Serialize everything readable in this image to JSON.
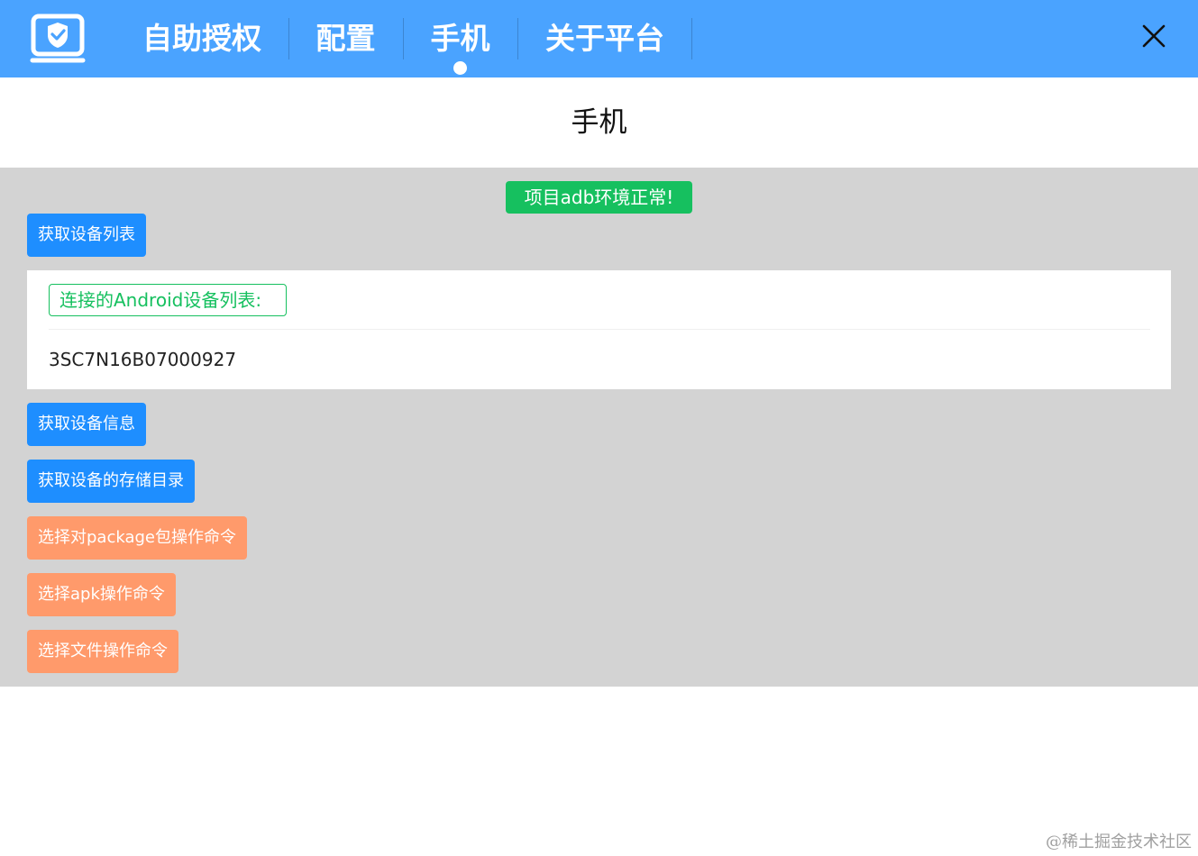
{
  "header": {
    "nav": [
      "自助授权",
      "配置",
      "手机",
      "关于平台"
    ],
    "active_index": 2
  },
  "page": {
    "title": "手机"
  },
  "status": {
    "text": "项目adb环境正常!"
  },
  "buttons": {
    "get_devices": "获取设备列表",
    "get_device_info": "获取设备信息",
    "get_storage_dir": "获取设备的存储目录",
    "package_commands": "选择对package包操作命令",
    "apk_commands": "选择apk操作命令",
    "file_commands": "选择文件操作命令"
  },
  "devices": {
    "title": "连接的Android设备列表:",
    "items": [
      "3SC7N16B07000927"
    ]
  },
  "watermark": "@稀土掘金技术社区",
  "icons": {
    "logo": "shield-monitor-icon",
    "close": "close-icon"
  },
  "colors": {
    "header": "#4aa3ff",
    "content_bg": "#d3d3d3",
    "primary_button": "#1e8eff",
    "warning_button": "#ff9a6b",
    "success": "#16c05f"
  }
}
